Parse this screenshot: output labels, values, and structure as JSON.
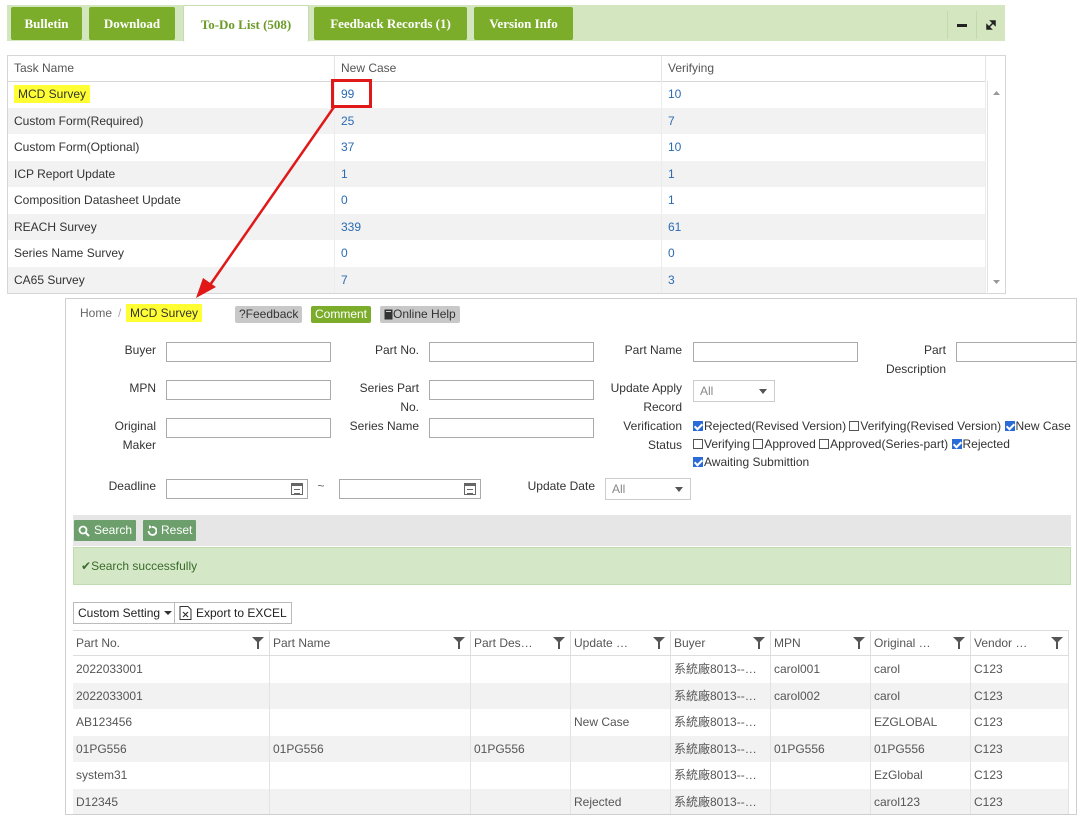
{
  "tabs": [
    {
      "label": "Bulletin",
      "active": false
    },
    {
      "label": "Download",
      "active": false
    },
    {
      "label": "To-Do List (508)",
      "active": true
    },
    {
      "label": "Feedback Records (1)",
      "active": false
    },
    {
      "label": "Version Info",
      "active": false
    }
  ],
  "taskgrid": {
    "headers": [
      "Task Name",
      "New Case",
      "Verifying"
    ],
    "rows": [
      {
        "name": "MCD Survey",
        "new_case": "99",
        "verifying": "10"
      },
      {
        "name": "Custom Form(Required)",
        "new_case": "25",
        "verifying": "7"
      },
      {
        "name": "Custom Form(Optional)",
        "new_case": "37",
        "verifying": "10"
      },
      {
        "name": "ICP Report Update",
        "new_case": "1",
        "verifying": "1"
      },
      {
        "name": "Composition Datasheet Update",
        "new_case": "0",
        "verifying": "1"
      },
      {
        "name": "REACH Survey",
        "new_case": "339",
        "verifying": "61"
      },
      {
        "name": "Series Name Survey",
        "new_case": "0",
        "verifying": "0"
      },
      {
        "name": "CA65 Survey",
        "new_case": "7",
        "verifying": "3"
      }
    ]
  },
  "colors": {
    "tab_green": "#7cad2a",
    "highlight": "#ffff33",
    "arrow_red": "#e01818",
    "link_blue": "#2a6bb3"
  },
  "panel": {
    "breadcrumb": {
      "home": "Home",
      "sep": "/",
      "current": "MCD Survey"
    },
    "top_buttons": {
      "feedback": "?Feedback",
      "comment": "Comment",
      "help": "Online Help"
    },
    "form": {
      "buyer": "Buyer",
      "part_no": "Part No.",
      "part_name": "Part Name",
      "part_desc_1": "Part",
      "part_desc_2": "Description",
      "mpn": "MPN",
      "series_part_1": "Series Part",
      "series_part_2": "No.",
      "update_apply_1": "Update Apply",
      "update_apply_2": "Record",
      "update_apply_value": "All",
      "original_1": "Original",
      "original_2": "Maker",
      "series_name": "Series Name",
      "verification_1": "Verification",
      "verification_2": "Status",
      "deadline": "Deadline",
      "tilde": "~",
      "update_date": "Update Date",
      "update_date_value": "All"
    },
    "status_options": [
      {
        "label": "Rejected(Revised Version)",
        "checked": true
      },
      {
        "label": "Verifying(Revised Version)",
        "checked": false
      },
      {
        "label": "New Case",
        "checked": true
      },
      {
        "label": "Verifying",
        "checked": false
      },
      {
        "label": "Approved",
        "checked": false
      },
      {
        "label": "Approved(Series-part)",
        "checked": false
      },
      {
        "label": "Rejected",
        "checked": true
      },
      {
        "label": "Awaiting Submittion",
        "checked": true
      }
    ],
    "actions": {
      "search": "Search",
      "reset": "Reset"
    },
    "message": "Search successfully",
    "grid_tools": {
      "custom": "Custom Setting",
      "export": "Export to EXCEL"
    },
    "grid": {
      "headers": [
        "Part No.",
        "Part Name",
        "Part Des…",
        "Update …",
        "Buyer",
        "MPN",
        "Original …",
        "Vendor …"
      ],
      "rows": [
        {
          "part_no": "2022033001",
          "part_name": "",
          "part_desc": "",
          "update": "",
          "buyer": "系統廠8013--…",
          "mpn": "carol001",
          "original": "carol",
          "vendor": "C123"
        },
        {
          "part_no": "2022033001",
          "part_name": "",
          "part_desc": "",
          "update": "",
          "buyer": "系統廠8013--…",
          "mpn": "carol002",
          "original": "carol",
          "vendor": "C123"
        },
        {
          "part_no": "AB123456",
          "part_name": "",
          "part_desc": "",
          "update": "New Case",
          "buyer": "系統廠8013--…",
          "mpn": "",
          "original": "EZGLOBAL",
          "vendor": "C123"
        },
        {
          "part_no": "01PG556",
          "part_name": "01PG556",
          "part_desc": "01PG556",
          "update": "",
          "buyer": "系統廠8013--…",
          "mpn": "01PG556",
          "original": "01PG556",
          "vendor": "C123"
        },
        {
          "part_no": "system31",
          "part_name": "",
          "part_desc": "",
          "update": "",
          "buyer": "系統廠8013--…",
          "mpn": "",
          "original": "EzGlobal",
          "vendor": "C123"
        },
        {
          "part_no": "D12345",
          "part_name": "",
          "part_desc": "",
          "update": "Rejected",
          "buyer": "系統廠8013--…",
          "mpn": "",
          "original": "carol123",
          "vendor": "C123"
        }
      ]
    }
  }
}
